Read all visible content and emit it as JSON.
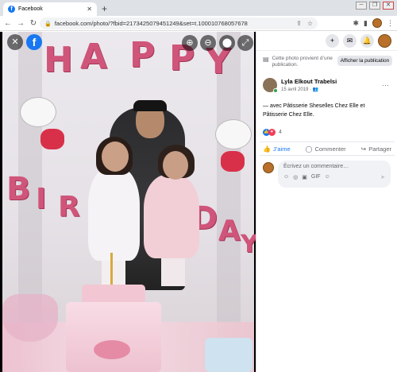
{
  "browser": {
    "tab_title": "Facebook",
    "tab_close": "✕",
    "new_tab": "+",
    "url": "facebook.com/photo/?fbid=2173425079451249&set=t.100010768057678",
    "window_controls": [
      "─",
      "❐",
      "✕"
    ]
  },
  "nav": {
    "back": "←",
    "forward": "→",
    "reload": "↻"
  },
  "photo": {
    "balloon_letters_top": [
      "H",
      "A",
      "P",
      "P",
      "Y"
    ],
    "balloon_letters_bottom": [
      "B",
      "I",
      "R",
      "D",
      "A",
      "Y"
    ],
    "close_icon": "✕",
    "fb_logo": "f",
    "zoom_in": "⊕",
    "zoom_out": "⊖",
    "tag": "⬤",
    "fullscreen": "⤢"
  },
  "panel": {
    "top_icons": [
      "+",
      "✉",
      "🔔"
    ],
    "notice_text": "Cette photo provient d’une publication.",
    "show_post_label": "Afficher la publication",
    "author_name": "Lyla Elkout Trabelsi",
    "post_date": "15 avril 2019 · 👥",
    "more_icon": "···",
    "post_text": "— avec Pâtisserie Sheselles Chez Elle et Pâtisserie Chez Elle.",
    "reaction_count": "4",
    "actions": {
      "like": "J’aime",
      "comment": "Commenter",
      "share": "Partager"
    },
    "comment_placeholder": "Écrivez un commentaire…",
    "comment_icons": [
      "☺",
      "◎",
      "▣",
      "GIF",
      "☺"
    ],
    "send_icon": "➤"
  },
  "colors": {
    "facebook_blue": "#1877f2",
    "love_red": "#f33e58",
    "balloon_pink": "#d0557a"
  }
}
